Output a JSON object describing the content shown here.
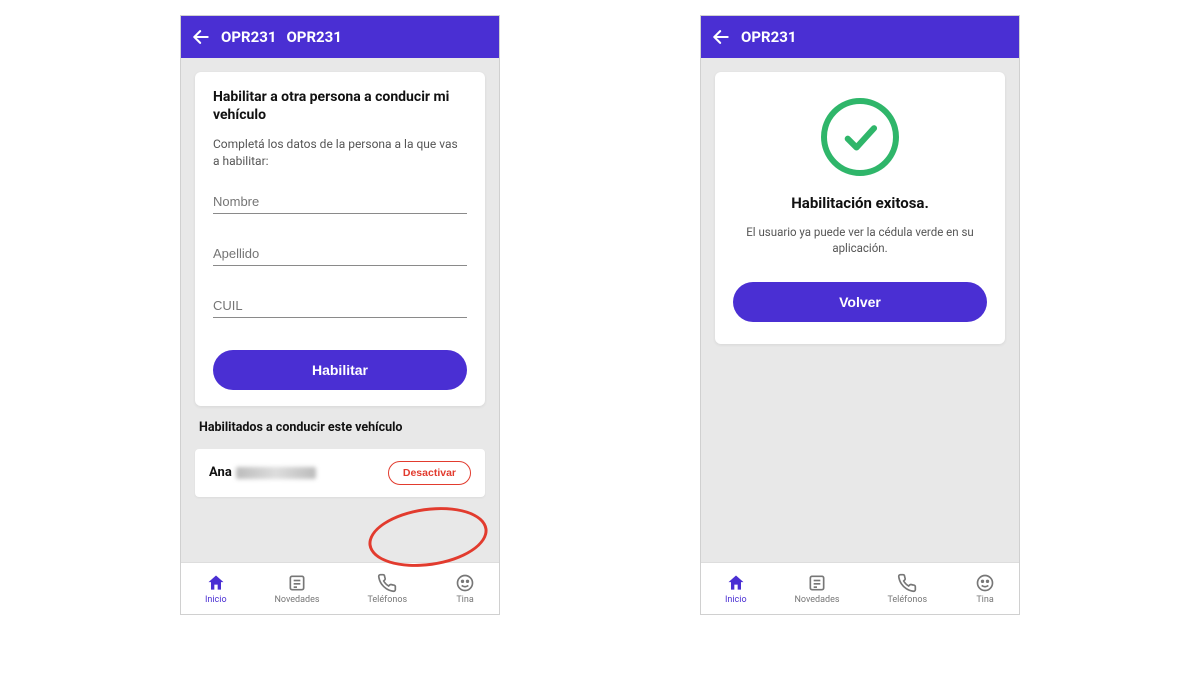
{
  "colors": {
    "brand": "#4a2fd3",
    "danger": "#e23b2e",
    "success": "#2fb66a"
  },
  "left": {
    "header": {
      "title1": "OPR231",
      "title2": "OPR231"
    },
    "card": {
      "title": "Habilitar a otra persona a conducir mi vehículo",
      "subtitle": "Completá los datos de la persona a la que vas a habilitar:",
      "fields": {
        "name_placeholder": "Nombre",
        "surname_placeholder": "Apellido",
        "cuil_placeholder": "CUIL"
      },
      "submit_label": "Habilitar"
    },
    "list": {
      "section_label": "Habilitados a conducir este vehículo",
      "row": {
        "visible_name": "Ana",
        "action_label": "Desactivar"
      }
    }
  },
  "right": {
    "header": {
      "title": "OPR231"
    },
    "success": {
      "title": "Habilitación exitosa.",
      "message": "El usuario ya puede ver la cédula verde en su aplicación.",
      "back_label": "Volver"
    }
  },
  "nav": {
    "items": [
      {
        "label": "Inicio",
        "active": true
      },
      {
        "label": "Novedades",
        "active": false
      },
      {
        "label": "Teléfonos",
        "active": false
      },
      {
        "label": "Tina",
        "active": false
      }
    ]
  }
}
